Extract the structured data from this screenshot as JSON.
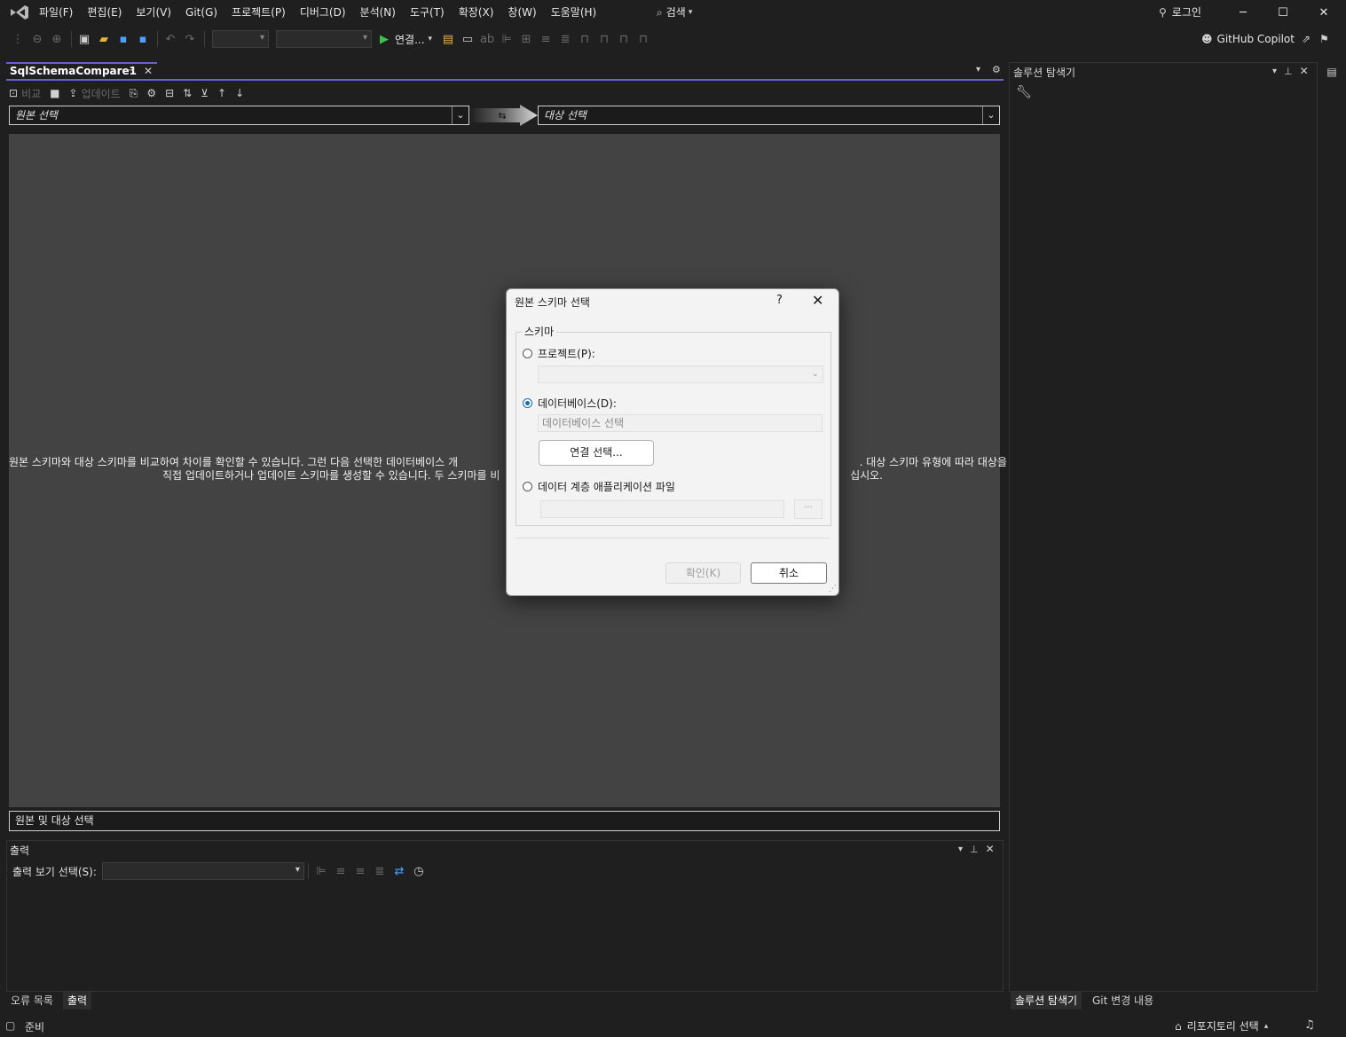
{
  "menubar": {
    "menus": [
      "파일(F)",
      "편집(E)",
      "보기(V)",
      "Git(G)",
      "프로젝트(P)",
      "디버그(D)",
      "분석(N)",
      "도구(T)",
      "확장(X)",
      "창(W)",
      "도움말(H)"
    ],
    "search_label": "검색",
    "login_label": "로그인"
  },
  "toolbar": {
    "run_label": "연결...",
    "copilot_label": "GitHub Copilot"
  },
  "document": {
    "tab_title": "SqlSchemaCompare1"
  },
  "schema_compare": {
    "compare_label": "비교",
    "update_label": "업데이트",
    "source_placeholder": "원본 선택",
    "target_placeholder": "대상 선택",
    "message_line1": "원본 스키마와 대상 스키마를 비교하여 차이를 확인할 수 있습니다. 그런 다음 선택한 데이터베이스 개",
    "message_line1_right": ". 대상 스키마 유형에 따라 대상을",
    "message_line2": "직접 업데이트하거나 업데이트 스키마를 생성할 수 있습니다. 두 스키마를 비",
    "message_line2_right": "십시오.",
    "status_text": "원본 및 대상 선택"
  },
  "output_panel": {
    "title": "출력",
    "show_output_label": "출력 보기 선택(S):",
    "tabs": [
      "오류 목록",
      "출력"
    ]
  },
  "solution_explorer": {
    "title": "솔루션 탐색기",
    "tabs": [
      "솔루션 탐색기",
      "Git 변경 내용"
    ]
  },
  "statusbar": {
    "ready": "준비",
    "repo_label": "리포지토리 선택"
  },
  "dialog": {
    "title": "원본 스키마 선택",
    "help": "?",
    "group_label": "스키마",
    "project_label": "프로젝트(P):",
    "database_label": "데이터베이스(D):",
    "database_placeholder": "데이터베이스 선택",
    "select_connection": "연결 선택...",
    "dacpac_label": "데이터 계층 애플리케이션 파일",
    "browse": "...",
    "ok": "확인(K)",
    "cancel": "취소",
    "selected_option": "database"
  }
}
